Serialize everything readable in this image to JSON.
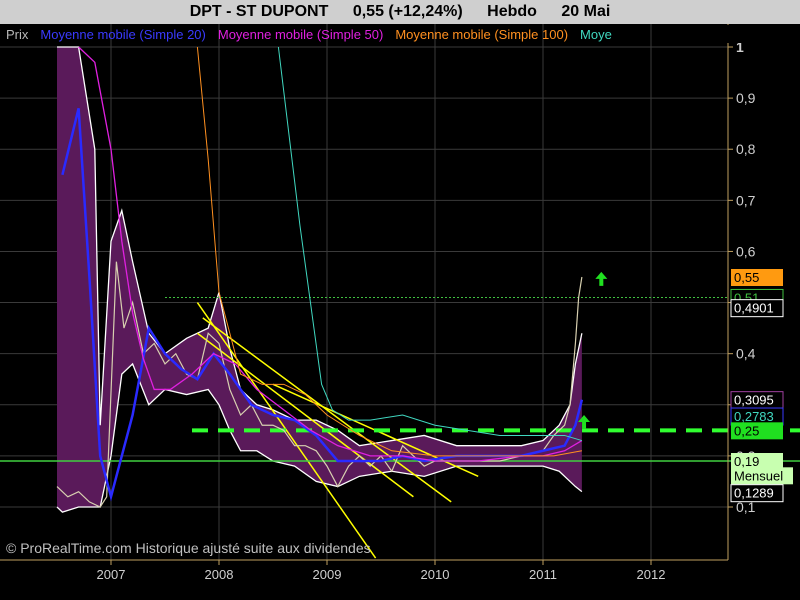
{
  "header": {
    "instrument": "DPT - ST DUPONT",
    "price_change": "0,55 (+12,24%)",
    "period": "Hebdo",
    "date": "20 Mai"
  },
  "legend": [
    {
      "label": "Prix",
      "color": "#b8b8b8"
    },
    {
      "label": "Moyenne mobile (Simple 20)",
      "color": "#3a3aff"
    },
    {
      "label": "Moyenne mobile (Simple 50)",
      "color": "#e020e0"
    },
    {
      "label": "Moyenne mobile (Simple 100)",
      "color": "#ff9020"
    },
    {
      "label": "Moye",
      "color": "#40d8c0"
    }
  ],
  "copyright": "© ProRealTime.com Historique ajusté suite aux dividendes",
  "colors": {
    "background": "#000000",
    "price": "#d8d0b0",
    "bollinger_fill": "#5a1a5a",
    "ma20": "#2a2aff",
    "ma50": "#e020e0",
    "ma100": "#ff9020",
    "ma200": "#40d8c0",
    "trend": "#ffff00",
    "support_dashed": "#30ff30",
    "support_solid": "#40d040",
    "arrow": "#20e020"
  },
  "chart_data": {
    "type": "line",
    "period": "weekly",
    "x_tick_labels": [
      "2007",
      "2008",
      "2009",
      "2010",
      "2011",
      "2012"
    ],
    "ylim": [
      0,
      1
    ],
    "y_tick_labels": [
      "0,1",
      "0,2",
      "0,3",
      "0,4",
      "0,5",
      "0,6",
      "0,7",
      "0,8",
      "0,9",
      "1"
    ],
    "grid": true,
    "series": [
      {
        "name": "Prix",
        "x": [
          2006.5,
          2006.6,
          2006.7,
          2006.8,
          2006.9,
          2006.96,
          2007.05,
          2007.12,
          2007.2,
          2007.3,
          2007.4,
          2007.5,
          2007.6,
          2007.7,
          2007.8,
          2007.9,
          2008.0,
          2008.1,
          2008.2,
          2008.3,
          2008.4,
          2008.5,
          2008.6,
          2008.7,
          2008.8,
          2008.9,
          2009.0,
          2009.1,
          2009.2,
          2009.3,
          2009.4,
          2009.5,
          2009.6,
          2009.7,
          2009.8,
          2009.9,
          2010.0,
          2010.2,
          2010.4,
          2010.6,
          2010.8,
          2011.0,
          2011.1,
          2011.2,
          2011.25,
          2011.3,
          2011.33,
          2011.36
        ],
        "values": [
          0.14,
          0.12,
          0.13,
          0.11,
          0.1,
          0.12,
          0.58,
          0.45,
          0.5,
          0.4,
          0.42,
          0.38,
          0.4,
          0.36,
          0.35,
          0.44,
          0.42,
          0.33,
          0.28,
          0.3,
          0.26,
          0.26,
          0.25,
          0.22,
          0.22,
          0.21,
          0.18,
          0.14,
          0.18,
          0.2,
          0.18,
          0.2,
          0.17,
          0.22,
          0.2,
          0.18,
          0.19,
          0.19,
          0.19,
          0.19,
          0.2,
          0.21,
          0.24,
          0.26,
          0.3,
          0.42,
          0.51,
          0.55
        ]
      },
      {
        "name": "Moyenne mobile (Simple 20)",
        "x": [
          2006.55,
          2006.7,
          2006.8,
          2006.9,
          2007.0,
          2007.2,
          2007.35,
          2007.5,
          2007.65,
          2007.8,
          2007.95,
          2008.1,
          2008.3,
          2008.5,
          2008.7,
          2008.9,
          2009.1,
          2009.3,
          2009.5,
          2009.7,
          2009.9,
          2010.2,
          2010.5,
          2010.8,
          2011.0,
          2011.2,
          2011.3,
          2011.36
        ],
        "values": [
          0.75,
          0.88,
          0.55,
          0.2,
          0.12,
          0.28,
          0.45,
          0.4,
          0.37,
          0.35,
          0.4,
          0.36,
          0.3,
          0.28,
          0.27,
          0.24,
          0.19,
          0.19,
          0.19,
          0.2,
          0.19,
          0.2,
          0.2,
          0.2,
          0.21,
          0.22,
          0.26,
          0.31
        ]
      },
      {
        "name": "Moyenne mobile (Simple 50)",
        "x": [
          2006.7,
          2006.85,
          2007.0,
          2007.1,
          2007.2,
          2007.3,
          2007.4,
          2007.55,
          2007.75,
          2007.95,
          2008.15,
          2008.35,
          2008.6,
          2008.85,
          2009.1,
          2009.4,
          2009.7,
          2010.0,
          2010.4,
          2010.8,
          2011.0,
          2011.2,
          2011.36
        ],
        "values": [
          1.0,
          0.97,
          0.8,
          0.62,
          0.48,
          0.39,
          0.33,
          0.33,
          0.36,
          0.4,
          0.38,
          0.33,
          0.29,
          0.25,
          0.22,
          0.2,
          0.2,
          0.19,
          0.19,
          0.2,
          0.2,
          0.21,
          0.23
        ]
      },
      {
        "name": "Moyenne mobile (Simple 100)",
        "x": [
          2007.8,
          2007.9,
          2008.0,
          2008.2,
          2008.4,
          2008.6,
          2008.8,
          2009.0,
          2009.3,
          2009.6,
          2010.0,
          2010.4,
          2010.8,
          2011.1,
          2011.36
        ],
        "values": [
          1.0,
          0.78,
          0.52,
          0.36,
          0.34,
          0.34,
          0.32,
          0.28,
          0.24,
          0.21,
          0.2,
          0.2,
          0.2,
          0.2,
          0.21
        ]
      },
      {
        "name": "Moye",
        "x": [
          2008.55,
          2008.75,
          2008.95,
          2009.05,
          2009.2,
          2009.4,
          2009.7,
          2010.0,
          2010.3,
          2010.6,
          2010.9,
          2011.2,
          2011.36
        ],
        "values": [
          1.0,
          0.65,
          0.34,
          0.29,
          0.27,
          0.27,
          0.28,
          0.26,
          0.25,
          0.24,
          0.24,
          0.24,
          0.23
        ]
      }
    ],
    "bollinger_bands": {
      "x": [
        2006.5,
        2006.55,
        2006.7,
        2006.85,
        2006.9,
        2007.0,
        2007.1,
        2007.2,
        2007.35,
        2007.5,
        2007.7,
        2007.9,
        2008.0,
        2008.1,
        2008.2,
        2008.35,
        2008.5,
        2008.7,
        2008.9,
        2009.1,
        2009.3,
        2009.6,
        2009.9,
        2010.2,
        2010.5,
        2010.8,
        2011.0,
        2011.15,
        2011.25,
        2011.3,
        2011.36
      ],
      "upper": [
        1.0,
        1.0,
        1.0,
        0.8,
        0.26,
        0.62,
        0.68,
        0.58,
        0.44,
        0.4,
        0.43,
        0.45,
        0.52,
        0.41,
        0.33,
        0.3,
        0.29,
        0.27,
        0.27,
        0.25,
        0.22,
        0.23,
        0.24,
        0.22,
        0.22,
        0.22,
        0.23,
        0.26,
        0.3,
        0.38,
        0.44
      ]
    },
    "bollinger_lower": [
      0.1,
      0.09,
      0.1,
      0.1,
      0.1,
      0.2,
      0.36,
      0.38,
      0.3,
      0.33,
      0.32,
      0.33,
      0.3,
      0.25,
      0.21,
      0.21,
      0.19,
      0.18,
      0.15,
      0.14,
      0.16,
      0.17,
      0.16,
      0.18,
      0.18,
      0.18,
      0.18,
      0.17,
      0.15,
      0.14,
      0.13
    ],
    "trendlines": [
      {
        "x": [
          2007.8,
          2009.45
        ],
        "values": [
          0.5,
          0.0
        ]
      },
      {
        "x": [
          2007.85,
          2010.15
        ],
        "values": [
          0.47,
          0.11
        ]
      },
      {
        "x": [
          2007.8,
          2009.8
        ],
        "values": [
          0.44,
          0.12
        ]
      },
      {
        "x": [
          2008.5,
          2010.4
        ],
        "values": [
          0.34,
          0.16
        ]
      }
    ],
    "horizontal_levels": [
      {
        "value": 0.51,
        "style": "dotted"
      },
      {
        "value": 0.25,
        "style": "dashed"
      },
      {
        "value": 0.19,
        "style": "solid"
      }
    ],
    "arrows": [
      {
        "x": 2011.54,
        "value": 0.56
      },
      {
        "x": 2011.38,
        "value": 0.28
      }
    ],
    "price_labels": [
      {
        "text": "0,55",
        "bg": "#ff9a10",
        "fg": "#000000"
      },
      {
        "text": "0,51",
        "bg": "#000000",
        "fg": "#40c040",
        "border": "#40c040"
      },
      {
        "text": "0,4901",
        "bg": "#000000",
        "fg": "#ffffff",
        "border": "#ffffff"
      },
      {
        "text": "0,3095",
        "bg": "#000000",
        "fg": "#ffffff",
        "border": "#a040a0"
      },
      {
        "text": "0,2783",
        "bg": "#000000",
        "fg": "#40d8c0",
        "border": "#3a3aff"
      },
      {
        "text": "0,25",
        "bg": "#20e020",
        "fg": "#000000"
      },
      {
        "text": "0,19",
        "bg": "#c8ffb0",
        "fg": "#000000"
      },
      {
        "text": "Mensuel",
        "bg": "#c8ffb0",
        "fg": "#000000"
      },
      {
        "text": "0,1289",
        "bg": "#000000",
        "fg": "#ffffff",
        "border": "#ffffff"
      }
    ]
  }
}
